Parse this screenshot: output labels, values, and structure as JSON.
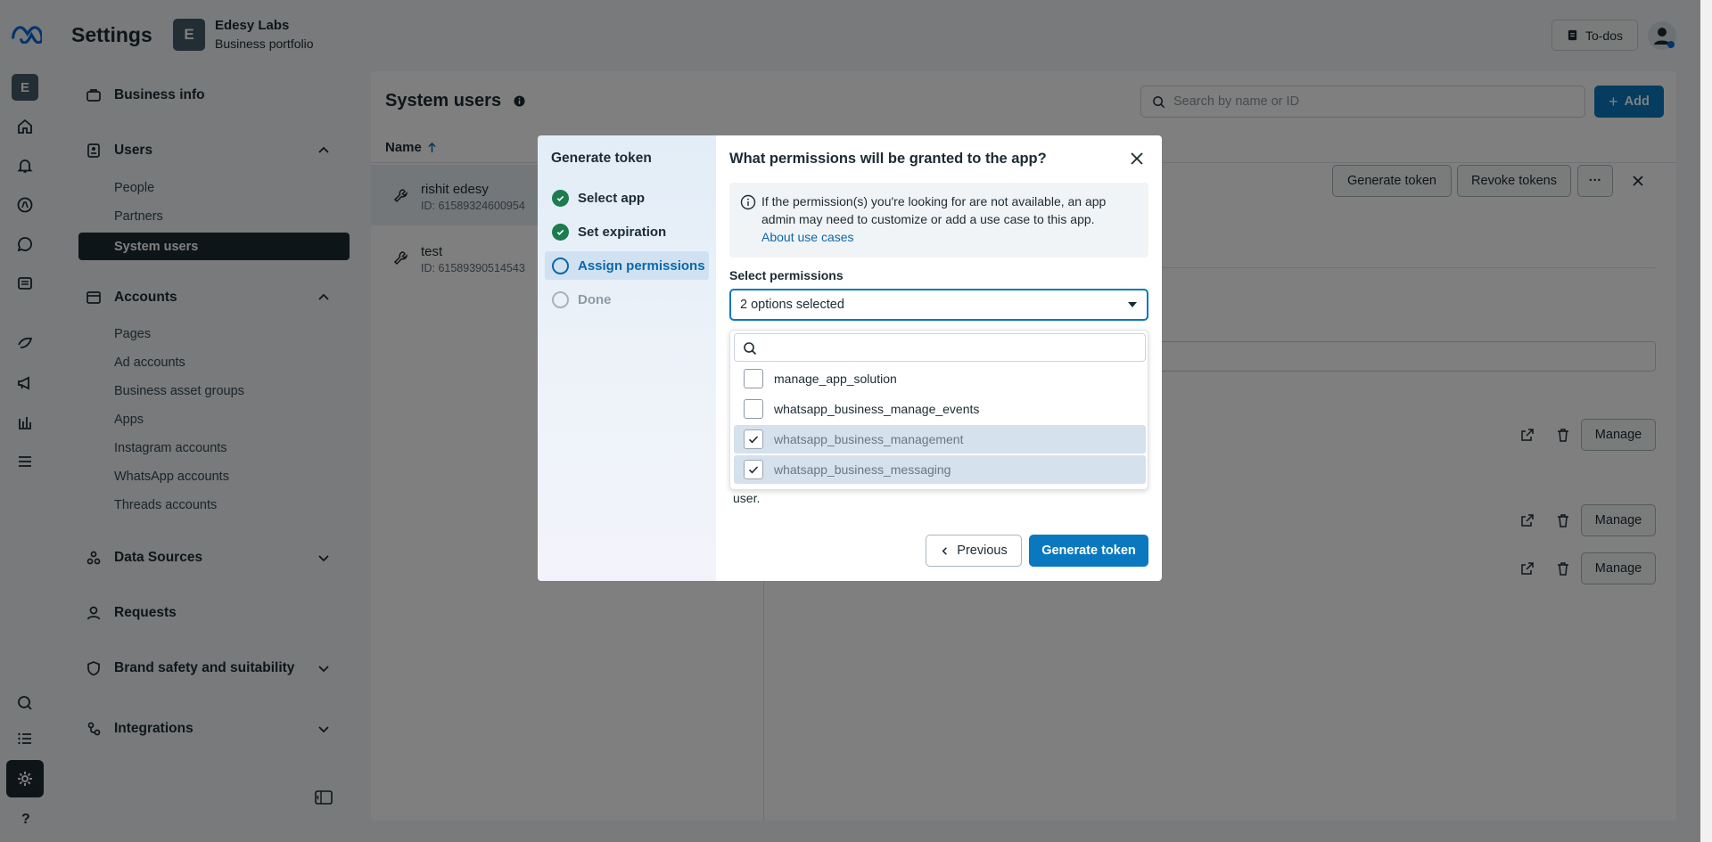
{
  "header": {
    "title": "Settings",
    "business_initial": "E",
    "business_name": "Edesy Labs",
    "business_sub": "Business portfolio",
    "todos_label": "To-dos"
  },
  "rail": {
    "business_initial": "E"
  },
  "sidebar": {
    "business_info": "Business info",
    "users": "Users",
    "users_items": [
      "People",
      "Partners",
      "System users"
    ],
    "accounts": "Accounts",
    "accounts_items": [
      "Pages",
      "Ad accounts",
      "Business asset groups",
      "Apps",
      "Instagram accounts",
      "WhatsApp accounts",
      "Threads accounts"
    ],
    "data_sources": "Data Sources",
    "requests": "Requests",
    "brand_safety": "Brand safety and suitability",
    "integrations": "Integrations"
  },
  "main": {
    "title": "System users",
    "search_placeholder": "Search by name or ID",
    "add_label": "Add",
    "name_column": "Name",
    "users": [
      {
        "name": "rishit edesy",
        "id": "ID: 61589324600954"
      },
      {
        "name": "test",
        "id": "ID: 61589390514543"
      }
    ],
    "generate_token_label": "Generate token",
    "revoke_tokens_label": "Revoke tokens",
    "more_label": "···",
    "manage_label": "Manage"
  },
  "modal": {
    "left_title": "Generate token",
    "steps": [
      {
        "label": "Select app",
        "state": "done"
      },
      {
        "label": "Set expiration",
        "state": "done"
      },
      {
        "label": "Assign permissions",
        "state": "current"
      },
      {
        "label": "Done",
        "state": "pending"
      }
    ],
    "title": "What permissions will be granted to the app?",
    "info_text": "If the permission(s) you're looking for are not available, an app admin may need to customize or add a use case to this app.",
    "info_link": "About use cases",
    "select_label": "Select permissions",
    "select_value": "2 options selected",
    "search_value": "",
    "options": [
      {
        "label": "manage_app_solution",
        "checked": false
      },
      {
        "label": "whatsapp_business_manage_events",
        "checked": false
      },
      {
        "label": "whatsapp_business_management",
        "checked": true
      },
      {
        "label": "whatsapp_business_messaging",
        "checked": true
      }
    ],
    "trailing_text": "user.",
    "previous_label": "Previous",
    "generate_label": "Generate token"
  },
  "colors": {
    "primary": "#0a78be",
    "dark": "#1c2b33",
    "success": "#1d7b4d"
  }
}
